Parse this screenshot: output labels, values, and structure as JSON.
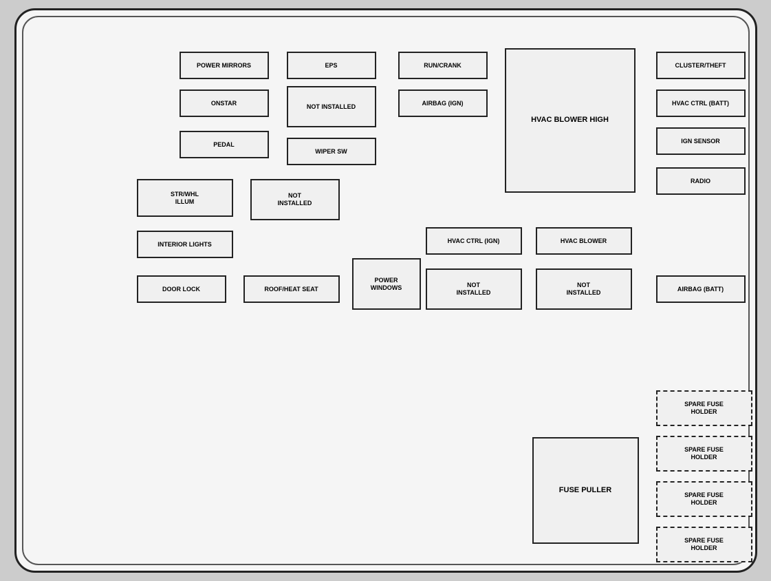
{
  "fuses": {
    "power_mirrors": "POWER MIRRORS",
    "eps": "EPS",
    "run_crank": "RUN/CRANK",
    "cluster_theft": "CLUSTER/THEFT",
    "onstar": "ONSTAR",
    "not_installed_1": "NOT INSTALLED",
    "airbag_ign": "AIRBAG (IGN)",
    "hvac_blower_high": "HVAC BLOWER HIGH",
    "hvac_ctrl_batt": "HVAC CTRL (BATT)",
    "pedal": "PEDAL",
    "wiper_sw": "WIPER SW",
    "ign_sensor": "IGN SENSOR",
    "str_whl_illum": "STR/WHL\nILLUM",
    "not_installed_2": "NOT\nINSTALLED",
    "radio": "RADIO",
    "interior_lights": "INTERIOR LIGHTS",
    "hvac_ctrl_ign": "HVAC CTRL (IGN)",
    "hvac_blower": "HVAC BLOWER",
    "door_lock": "DOOR LOCK",
    "roof_heat_seat": "ROOF/HEAT SEAT",
    "power_windows": "POWER\nWINDOWS",
    "not_installed_3": "NOT\nINSTALLED",
    "not_installed_4": "NOT\nINSTALLED",
    "airbag_batt": "AIRBAG (BATT)",
    "spare_fuse_1": "SPARE FUSE\nHOLDER",
    "spare_fuse_2": "SPARE FUSE\nHOLDER",
    "spare_fuse_3": "SPARE FUSE\nHOLDER",
    "spare_fuse_4": "SPARE FUSE\nHOLDER",
    "fuse_puller": "FUSE PULLER"
  }
}
